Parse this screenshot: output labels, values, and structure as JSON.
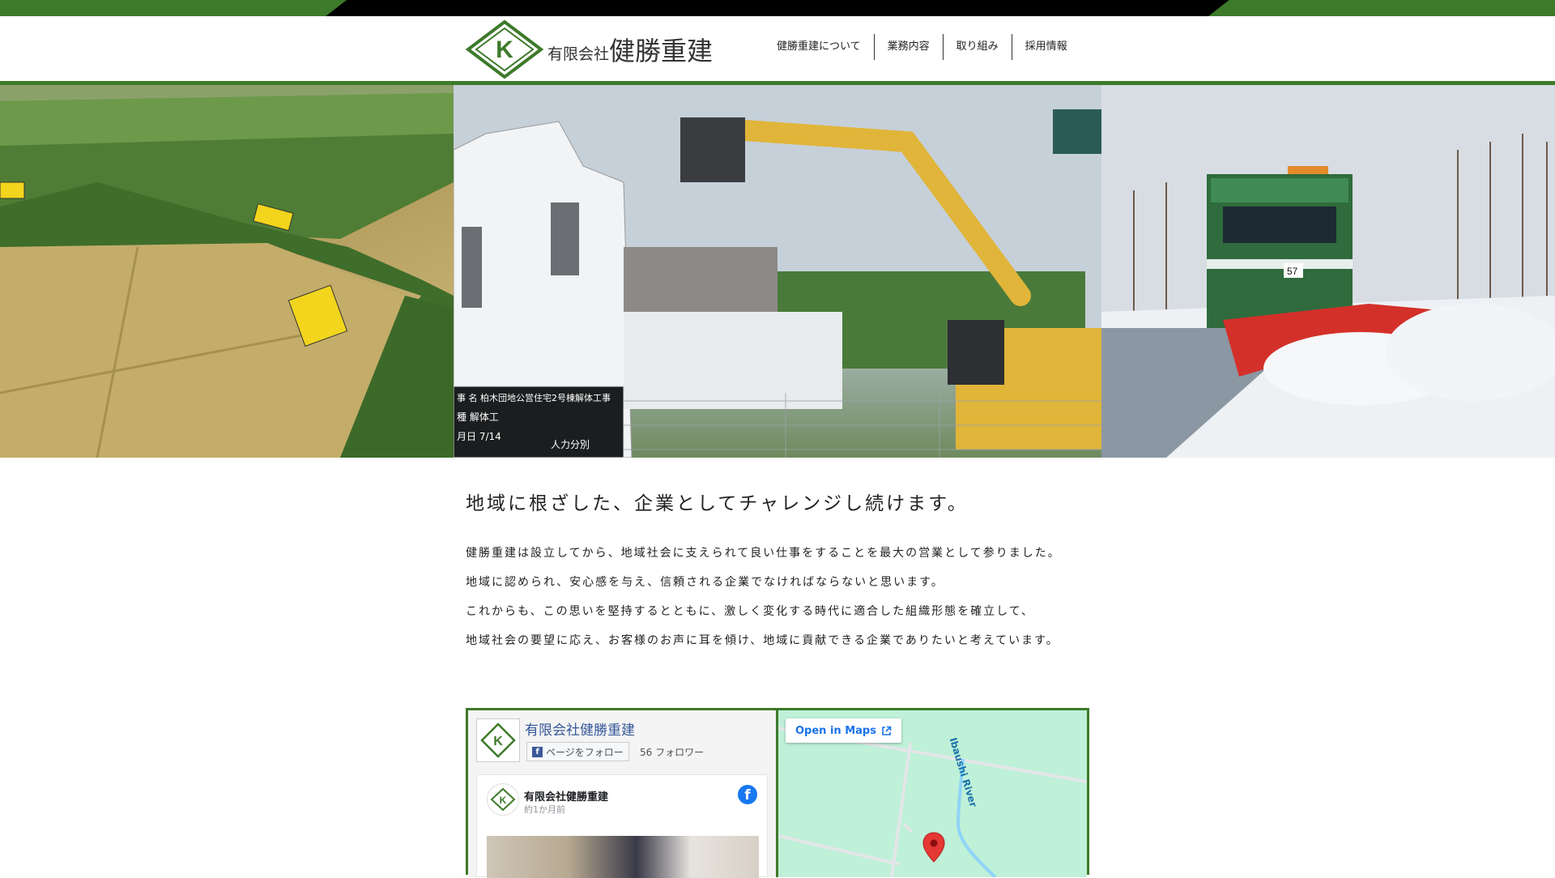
{
  "header": {
    "company_prefix": "有限会社",
    "company_name": "健勝重建",
    "logo_letter": "K",
    "nav": [
      "健勝重建について",
      "業務内容",
      "取り組み",
      "採用情報"
    ]
  },
  "hero": {
    "panels": [
      "farm-harvest",
      "demolition-excavator",
      "snow-plow-truck"
    ],
    "sign_text": [
      "事 名 柏木団地公営住宅2号棟解体工事",
      "種 解体工",
      "月日 7/14",
      "人力分別"
    ],
    "truck_number": "57"
  },
  "intro": {
    "title": "地域に根ざした、企業としてチャレンジし続けます。",
    "lines": [
      "健勝重建は設立してから、地域社会に支えられて良い仕事をすることを最大の営業として参りました。",
      "地域に認められ、安心感を与え、信頼される企業でなければならないと思います。",
      "これからも、この思いを堅持するとともに、激しく変化する時代に適合した組織形態を確立して、",
      "地域社会の要望に応え、お客様のお声に耳を傾け、地域に貢献できる企業でありたいと考えています。"
    ]
  },
  "facebook": {
    "page_title": "有限会社健勝重建",
    "follow_label": "ページをフォロー",
    "followers": "56 フォロワー",
    "post_author": "有限会社健勝重建",
    "post_time": "約1か月前"
  },
  "map": {
    "open_button": "Open in Maps",
    "river_label": "Ibaushi River"
  },
  "colors": {
    "brand_green": "#3d7a2a",
    "link_blue": "#365899",
    "map_water": "#bff0d8"
  }
}
